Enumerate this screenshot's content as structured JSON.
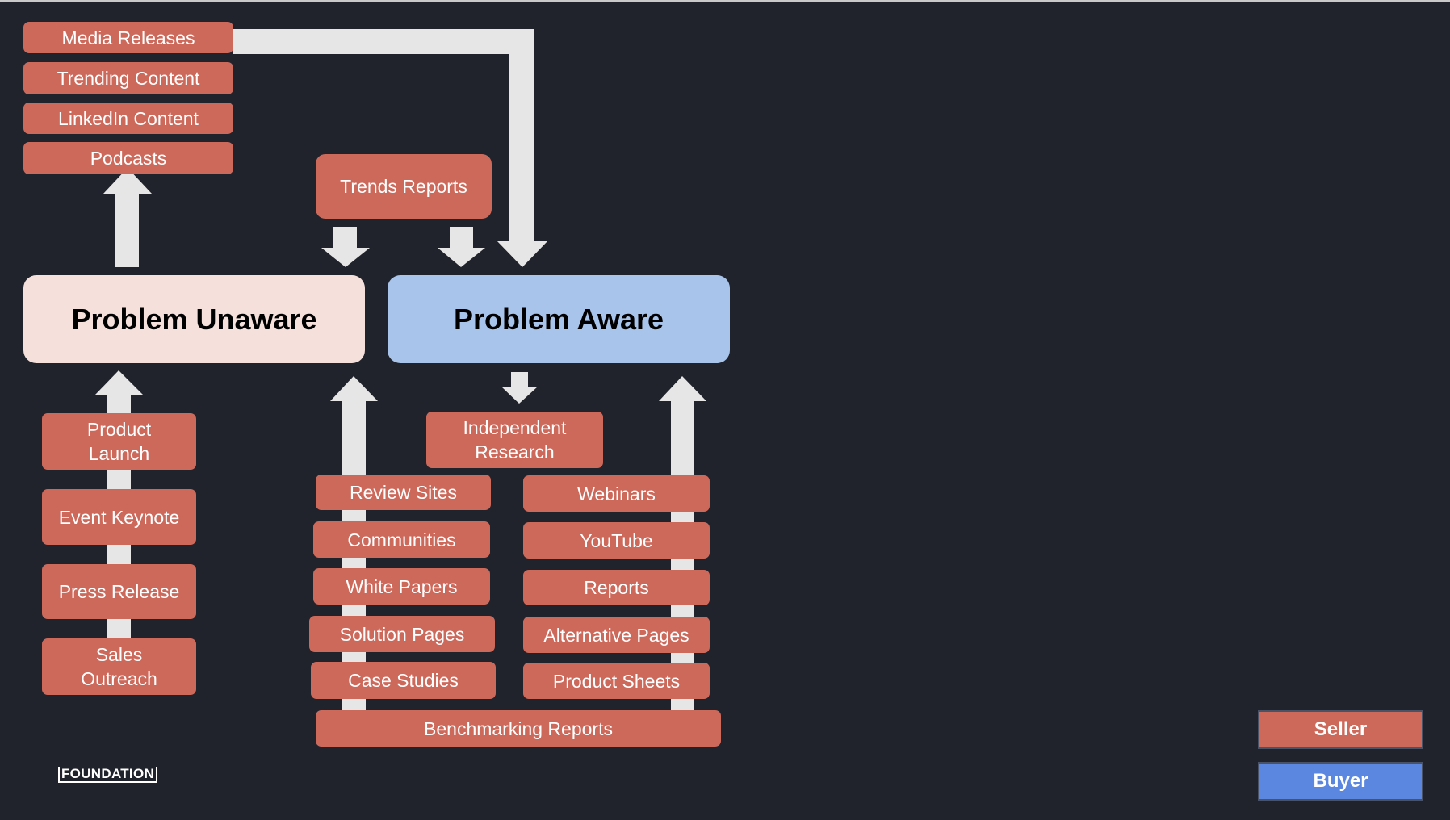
{
  "stages": {
    "unaware": {
      "label": "Problem Unaware",
      "color": "#f5e0db"
    },
    "aware": {
      "label": "Problem Aware",
      "color": "#a8c4ea"
    }
  },
  "colors": {
    "seller": "#cc695b",
    "buyer": "#5b87e0",
    "arrow": "#e6e6e6",
    "background": "#20232b"
  },
  "top_left_stack": [
    "Media Releases",
    "Trending Content",
    "LinkedIn Content",
    "Podcasts"
  ],
  "trends_reports": "Trends Reports",
  "unaware_inputs": [
    "Product Launch",
    "Event Keynote",
    "Press Release",
    "Sales Outreach"
  ],
  "independent_research": "Independent Research",
  "left_column": [
    "Review Sites",
    "Communities",
    "White Papers",
    "Solution Pages",
    "Case Studies"
  ],
  "right_column": [
    "Webinars",
    "YouTube",
    "Reports",
    "Alternative Pages",
    "Product Sheets"
  ],
  "benchmarking": "Benchmarking Reports",
  "legend": {
    "seller": "Seller",
    "buyer": "Buyer"
  },
  "logo": "FOUNDATION"
}
